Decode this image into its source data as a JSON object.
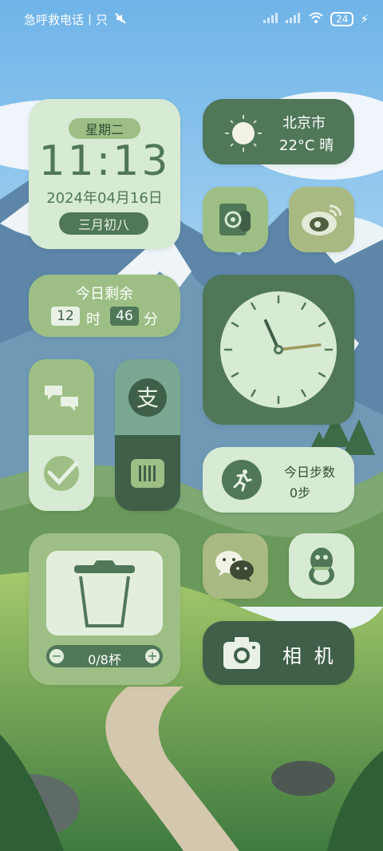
{
  "status_bar": {
    "carrier_text": "急呼救电话丨只",
    "battery": "24"
  },
  "date_widget": {
    "weekday": "星期二",
    "time": "11:13",
    "date": "2024年04月16日",
    "lunar": "三月初八"
  },
  "weather": {
    "city": "北京市",
    "temp": "22°C 晴"
  },
  "remaining": {
    "title": "今日剩余",
    "hours": "12",
    "hours_unit": "时",
    "minutes": "46",
    "minutes_unit": "分"
  },
  "steps": {
    "title": "今日步数",
    "count": "0步"
  },
  "water": {
    "count": "0/8杯"
  },
  "camera": {
    "label": "相 机"
  },
  "colors": {
    "light": "#d7ead3",
    "mid": "#9dbf86",
    "dark": "#4f7758"
  }
}
